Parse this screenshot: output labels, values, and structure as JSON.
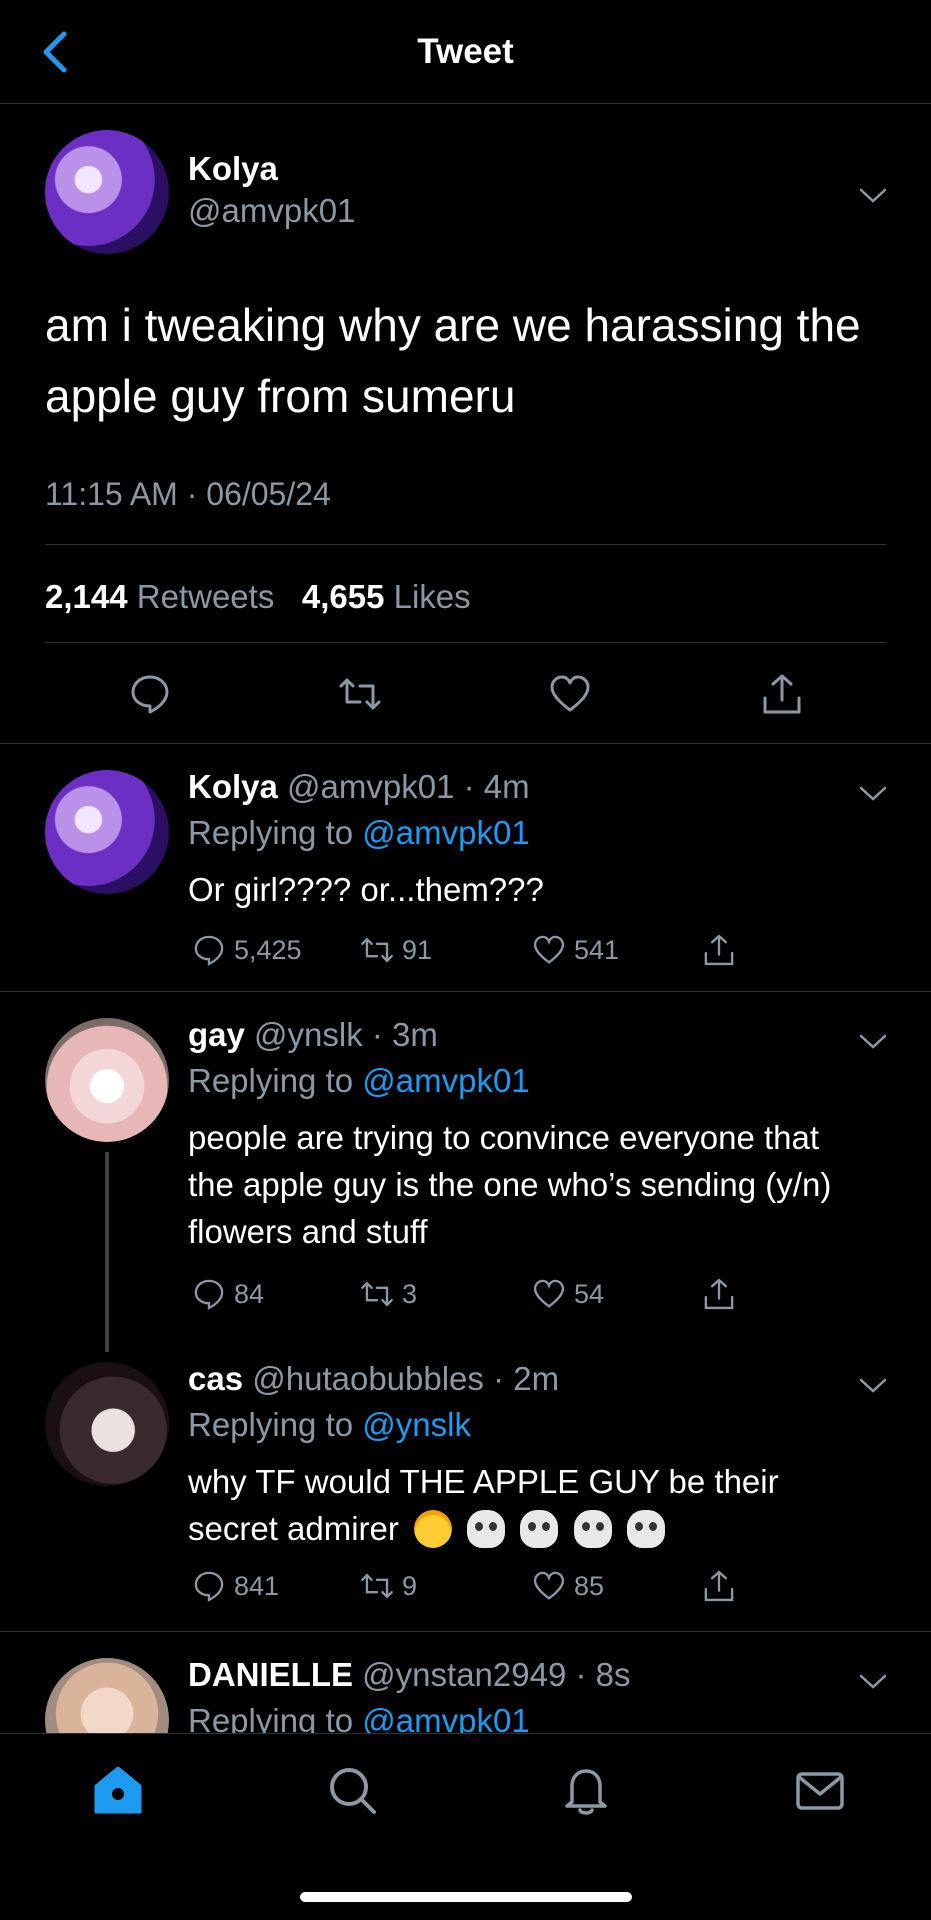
{
  "header": {
    "title": "Tweet"
  },
  "main_tweet": {
    "name": "Kolya",
    "handle": "@amvpk01",
    "text": "am i tweaking why are we harassing the apple guy from sumeru",
    "timestamp": "11:15 AM · 06/05/24",
    "retweets": "2,144",
    "retweets_label": "Retweets",
    "likes": "4,655",
    "likes_label": "Likes"
  },
  "replies": [
    {
      "name": "Kolya",
      "handle_time": "@amvpk01 · 4m",
      "replying_prefix": "Replying to ",
      "replying_to": "@amvpk01",
      "text": "Or girl???? or...them???",
      "comments": "5,425",
      "retweets": "91",
      "likes": "541"
    },
    {
      "name": "gay",
      "handle_time": "@ynslk · 3m",
      "replying_prefix": "Replying to ",
      "replying_to": "@amvpk01",
      "text": "people are trying to convince everyone that the apple guy is the one who’s sending (y/n) flowers and stuff",
      "comments": "84",
      "retweets": "3",
      "likes": "54"
    },
    {
      "name": "cas",
      "handle_time": "@hutaobubbles · 2m",
      "replying_prefix": "Replying to ",
      "replying_to": "@ynslk",
      "text": "why TF would THE APPLE GUY be their secret admirer",
      "comments": "841",
      "retweets": "9",
      "likes": "85"
    },
    {
      "name": "DANIELLE",
      "handle_time": "@ynstan2949 · 8s",
      "replying_prefix": "Replying to ",
      "replying_to": "@amvpk01"
    }
  ],
  "colors": {
    "accent": "#1d9bf0",
    "muted": "#8b98a5",
    "divider": "#2f3336",
    "background": "#000000"
  },
  "tabbar": {
    "items": [
      "home-icon",
      "search-icon",
      "bell-icon",
      "mail-icon"
    ],
    "active": "home-icon"
  }
}
